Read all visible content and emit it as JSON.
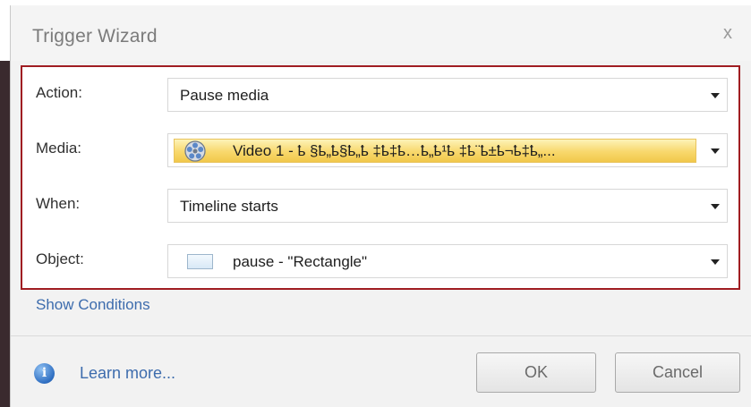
{
  "dialog": {
    "title": "Trigger Wizard",
    "close_label": "x"
  },
  "form": {
    "rows": [
      {
        "label": "Action:",
        "value": "Pause media"
      },
      {
        "label": "Media:",
        "value": "Video 1 - ҍ §ҍ„ҍ§ҍ„ҍ ‡ҍ‡ҍ…ҍ„ҍ¹ҍ ‡ҍ¨ҍ±ҍ¬ҍ‡ҍ„..."
      },
      {
        "label": "When:",
        "value": "Timeline starts"
      },
      {
        "label": "Object:",
        "value": "pause - \"Rectangle\""
      }
    ]
  },
  "links": {
    "show_conditions": "Show Conditions",
    "learn_more": "Learn more..."
  },
  "buttons": {
    "ok": "OK",
    "cancel": "Cancel"
  },
  "colors": {
    "frame_border": "#a01d22",
    "link": "#3d6cad",
    "media_highlight": "#f8d86c"
  },
  "icons": {
    "close": "close-icon",
    "dropdown": "chevron-down-icon",
    "media": "film-reel-icon",
    "object": "rectangle-shape-icon",
    "info": "info-icon"
  }
}
